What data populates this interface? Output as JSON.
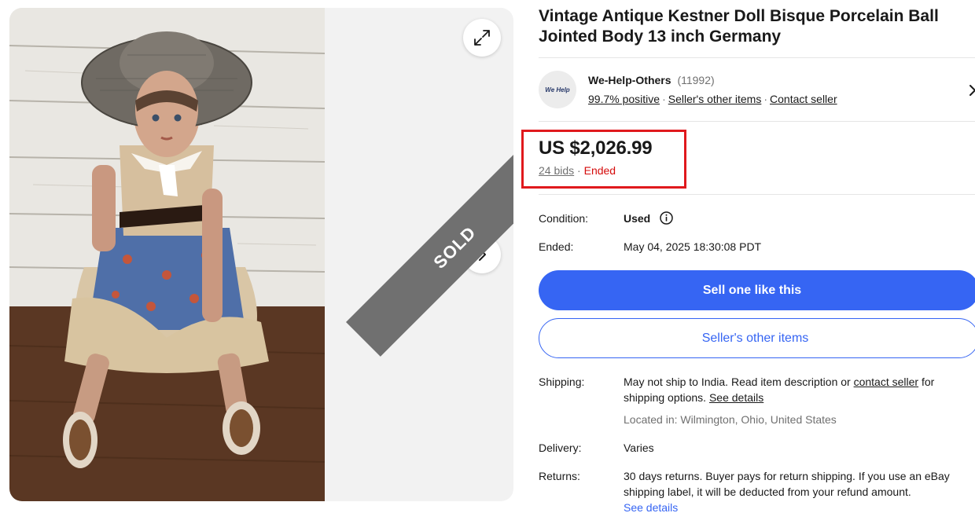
{
  "listing": {
    "title": "Vintage Antique Kestner Doll Bisque Porcelain Ball Jointed Body 13 inch Germany",
    "sold_banner": "SOLD"
  },
  "seller": {
    "logo_text": "We Help",
    "name": "We-Help-Others",
    "feedback_count": "(11992)",
    "positive": "99.7% positive",
    "other_items": "Seller's other items",
    "contact": "Contact seller"
  },
  "price": {
    "amount": "US $2,026.99",
    "bids": "24 bids",
    "separator": "·",
    "status": "Ended"
  },
  "details": {
    "condition_label": "Condition:",
    "condition_value": "Used",
    "ended_label": "Ended:",
    "ended_value": "May 04, 2025 18:30:08 PDT"
  },
  "buttons": {
    "primary": "Sell one like this",
    "secondary": "Seller's other items"
  },
  "shipping": {
    "label": "Shipping:",
    "text1": "May not ship to India. Read item description or",
    "contact_link": "contact seller",
    "text2": "for",
    "text3": "shipping options.",
    "see_details": "See details",
    "location": "Located in: Wilmington, Ohio, United States"
  },
  "delivery": {
    "label": "Delivery:",
    "value": "Varies"
  },
  "returns": {
    "label": "Returns:",
    "text": "30 days returns. Buyer pays for return shipping. If you use an eBay shipping label, it will be deducted from your refund amount.",
    "see_details": "See details"
  },
  "colors": {
    "accent": "#3665f3",
    "ended": "#d50b0b",
    "highlight_box": "#e0191d",
    "sold_ribbon": "#707070"
  },
  "icons": [
    "expand-icon",
    "chevron-right-icon",
    "info-icon"
  ]
}
